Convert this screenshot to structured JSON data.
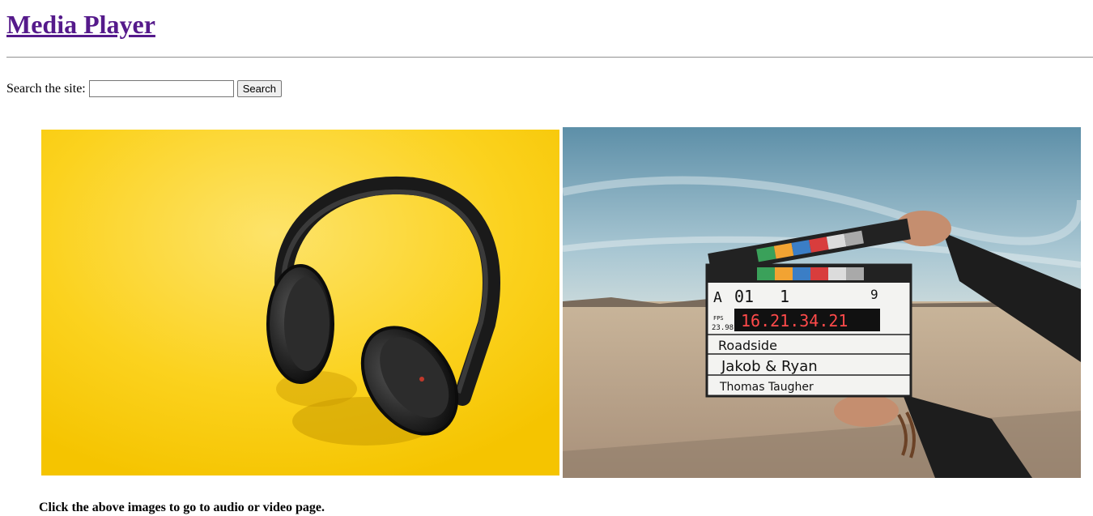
{
  "header": {
    "title": "Media Player"
  },
  "search": {
    "label": "Search the site:",
    "value": "",
    "placeholder": "",
    "button_label": "Search"
  },
  "media": {
    "audio_image": {
      "alt": "headphones-image"
    },
    "video_image": {
      "alt": "clapperboard-image",
      "slate": {
        "scene": "01",
        "take": "1",
        "roll": "9",
        "fps": "23.98",
        "timecode": "16.21.34.21",
        "production": "Roadside",
        "director": "Jakob & Ryan",
        "camera": "Thomas Taugher"
      }
    }
  },
  "footer": {
    "caption": "Click the above images to go to audio or video page."
  }
}
